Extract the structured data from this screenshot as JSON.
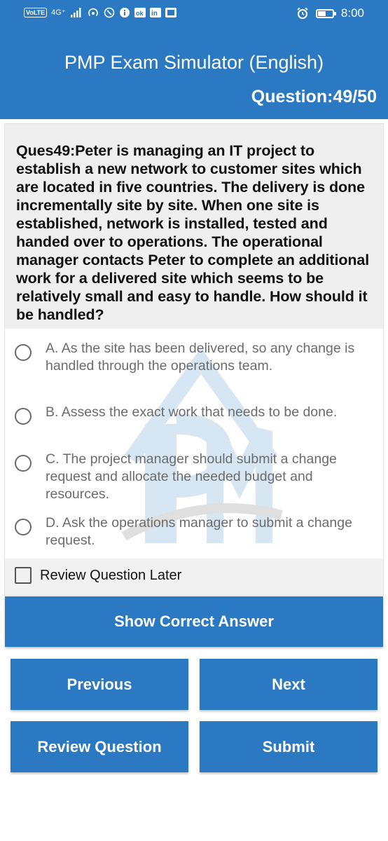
{
  "status_bar": {
    "volte": "VoLTE",
    "network": "4G⁺",
    "time": "8:00",
    "battery_level": 0.55
  },
  "app_bar": {
    "title": "PMP Exam Simulator (English)",
    "question_counter": "Question:49/50"
  },
  "question": {
    "text": "Ques49:Peter is managing an IT project to establish a new network to customer sites which are located in five countries. The delivery is done incrementally site by site. When one site is established, network is installed, tested and handed over to operations. The operational manager contacts Peter to complete an additional work for a delivered site which seems to be relatively small and easy to handle. How should it be handled?",
    "options": [
      {
        "label": "A. As the site has been delivered, so any change is handled through the operations team."
      },
      {
        "label": "B. Assess the exact work that needs to be done."
      },
      {
        "label": "C. The project manager should submit a change request and allocate the needed budget and resources."
      },
      {
        "label": "D. Ask the operations manager to submit a change request."
      }
    ]
  },
  "review_later": {
    "label": "Review Question Later",
    "checked": false
  },
  "buttons": {
    "show_answer": "Show Correct Answer",
    "previous": "Previous",
    "next": "Next",
    "review": "Review Question",
    "submit": "Submit"
  },
  "colors": {
    "primary": "#2a79c2",
    "question_bg": "#efefef"
  }
}
